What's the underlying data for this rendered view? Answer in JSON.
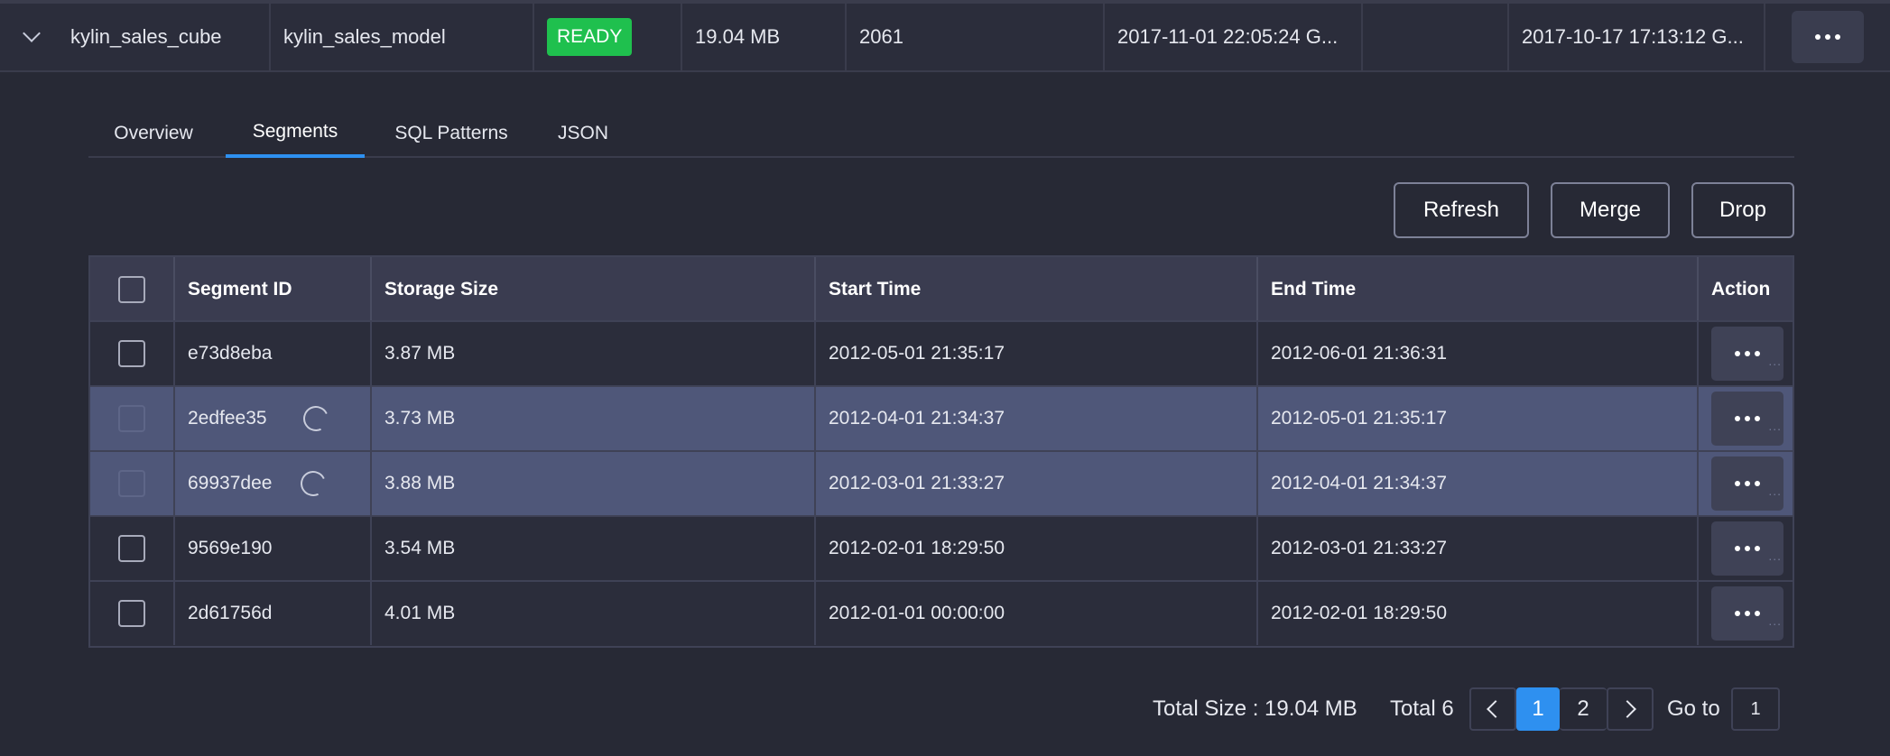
{
  "cube": {
    "name": "kylin_sales_cube",
    "model": "kylin_sales_model",
    "status": "READY",
    "size": "19.04 MB",
    "source_records": "2061",
    "last_build_time": "2017-11-01 22:05:24 G...",
    "empty_col": "",
    "create_time": "2017-10-17 17:13:12 G..."
  },
  "tabs": [
    {
      "label": "Overview",
      "active": false
    },
    {
      "label": "Segments",
      "active": true
    },
    {
      "label": "SQL Patterns",
      "active": false
    },
    {
      "label": "JSON",
      "active": false
    }
  ],
  "toolbar": {
    "refresh_label": "Refresh",
    "merge_label": "Merge",
    "drop_label": "Drop"
  },
  "table": {
    "columns": [
      "Segment ID",
      "Storage Size",
      "Start Time",
      "End Time",
      "Action"
    ],
    "rows": [
      {
        "id": "e73d8eba",
        "size": "3.87 MB",
        "start": "2012-05-01 21:35:17",
        "end": "2012-06-01 21:36:31",
        "highlighted": false,
        "loading": false
      },
      {
        "id": "2edfee35",
        "size": "3.73 MB",
        "start": "2012-04-01 21:34:37",
        "end": "2012-05-01 21:35:17",
        "highlighted": true,
        "loading": true
      },
      {
        "id": "69937dee",
        "size": "3.88 MB",
        "start": "2012-03-01 21:33:27",
        "end": "2012-04-01 21:34:37",
        "highlighted": true,
        "loading": true
      },
      {
        "id": "9569e190",
        "size": "3.54 MB",
        "start": "2012-02-01 18:29:50",
        "end": "2012-03-01 21:33:27",
        "highlighted": false,
        "loading": false
      },
      {
        "id": "2d61756d",
        "size": "4.01 MB",
        "start": "2012-01-01 00:00:00",
        "end": "2012-02-01 18:29:50",
        "highlighted": false,
        "loading": false
      }
    ],
    "action_overflow": "..."
  },
  "footer": {
    "total_size": "Total Size : 19.04 MB",
    "total": "Total 6",
    "pages": [
      "1",
      "2"
    ],
    "current_page": "1",
    "goto_label": "Go to",
    "goto_value": "1"
  },
  "colors": {
    "accent": "#2e90f0",
    "ready": "#1fc04e",
    "highlight_row": "#4f5779"
  }
}
